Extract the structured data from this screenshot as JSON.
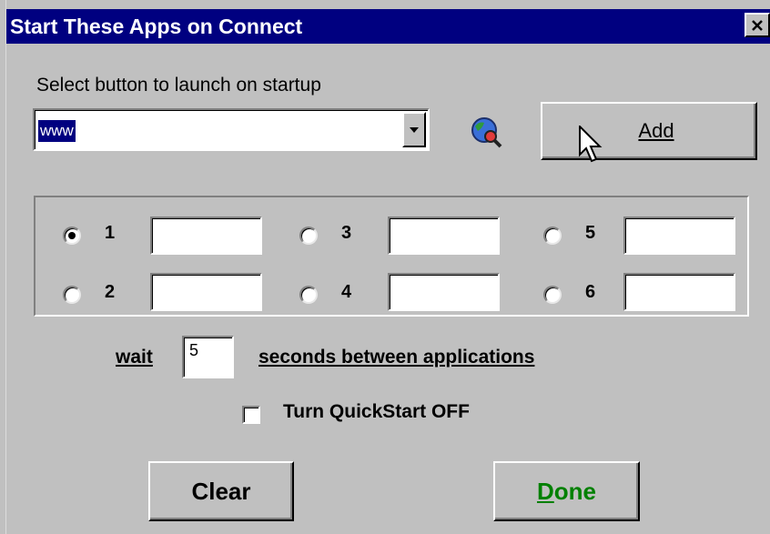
{
  "window": {
    "title": "Start These Apps on Connect",
    "close_label": "Close"
  },
  "launch": {
    "label": "Select button to launch on startup",
    "selected_value": "www",
    "add_button_label": "Add"
  },
  "slots": [
    {
      "number": "1",
      "checked": true,
      "value": ""
    },
    {
      "number": "2",
      "checked": false,
      "value": ""
    },
    {
      "number": "3",
      "checked": false,
      "value": ""
    },
    {
      "number": "4",
      "checked": false,
      "value": ""
    },
    {
      "number": "5",
      "checked": false,
      "value": ""
    },
    {
      "number": "6",
      "checked": false,
      "value": ""
    }
  ],
  "wait": {
    "prefix": "wait",
    "value": "5",
    "suffix": "seconds between applications"
  },
  "quickstart": {
    "label": "Turn QuickStart OFF",
    "checked": false
  },
  "buttons": {
    "clear": "Clear",
    "done_mnemonic": "D",
    "done_rest": "one"
  },
  "colors": {
    "title_bar": "#000080",
    "face": "#c0c0c0",
    "done_text": "#008000"
  },
  "icons": {
    "globe": "globe-magnifier-icon",
    "cursor": "mouse-pointer-icon"
  }
}
